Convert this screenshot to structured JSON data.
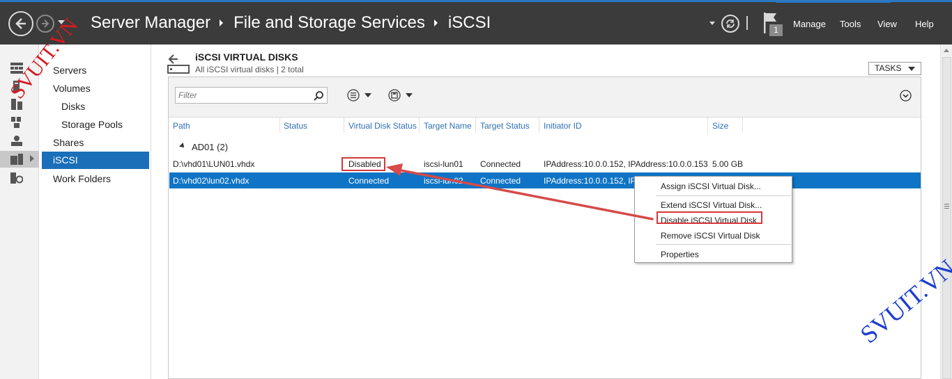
{
  "titlebar": {
    "breadcrumb": [
      "Server Manager",
      "File and Storage Services",
      "iSCSI"
    ],
    "notification_count": "1",
    "menu": [
      "Manage",
      "Tools",
      "View",
      "Help"
    ]
  },
  "nav": {
    "items": [
      {
        "label": "Servers"
      },
      {
        "label": "Volumes"
      },
      {
        "label": "Disks"
      },
      {
        "label": "Storage Pools"
      },
      {
        "label": "Shares"
      },
      {
        "label": "iSCSI"
      },
      {
        "label": "Work Folders"
      }
    ],
    "selected": "iSCSI"
  },
  "section": {
    "title": "iSCSI VIRTUAL DISKS",
    "subtitle": "All iSCSI virtual disks | 2 total",
    "tasks_label": "TASKS"
  },
  "toolbar": {
    "filter_placeholder": "Filter"
  },
  "table": {
    "columns": [
      "Path",
      "Status",
      "Virtual Disk Status",
      "Target Name",
      "Target Status",
      "Initiator ID",
      "Size"
    ],
    "group_label": "AD01 (2)",
    "rows": [
      {
        "path": "D:\\vhd01\\LUN01.vhdx",
        "status": "",
        "vd_status": "Disabled",
        "target": "iscsi-lun01",
        "target_status": "Connected",
        "initiator": "IPAddress:10.0.0.152, IPAddress:10.0.0.153",
        "size": "5.00 GB",
        "selected": false
      },
      {
        "path": "D:\\vhd02\\lun02.vhdx",
        "status": "",
        "vd_status": "Connected",
        "target": "iscsi-lun02",
        "target_status": "Connected",
        "initiator": "IPAddress:10.0.0.152, IPA",
        "size": "",
        "selected": true
      }
    ]
  },
  "context_menu": {
    "items": [
      "Assign iSCSI Virtual Disk...",
      "Extend iSCSI Virtual Disk...",
      "Disable iSCSI Virtual Disk",
      "Remove iSCSI Virtual Disk",
      "Properties"
    ]
  },
  "watermark": "SVUIT.VN",
  "colors": {
    "titlebar": "#3b3b3b",
    "selection": "#1a6fb8",
    "highlight": "#d7373a",
    "column_header": "#2f6fb5"
  }
}
